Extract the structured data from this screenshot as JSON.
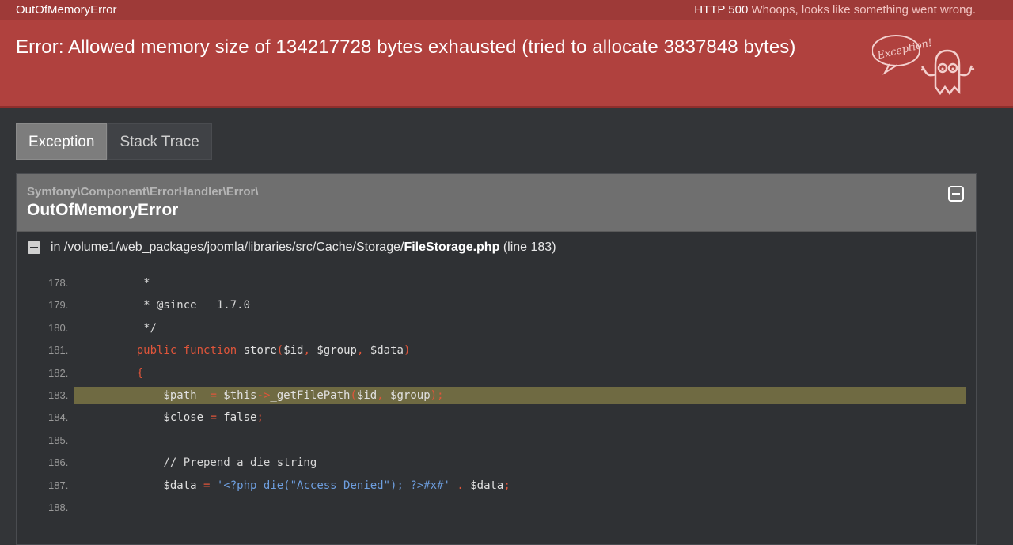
{
  "topbar": {
    "exception_name": "OutOfMemoryError",
    "status_code": "HTTP 500",
    "status_message": "Whoops, looks like something went wrong."
  },
  "error": {
    "message": "Error: Allowed memory size of 134217728 bytes exhausted (tried to allocate 3837848 bytes)"
  },
  "mascot": {
    "bubble_text": "Exception!"
  },
  "tabs": [
    {
      "label": "Exception",
      "active": true
    },
    {
      "label": "Stack Trace",
      "active": false
    }
  ],
  "exception": {
    "namespace": "Symfony\\Component\\ErrorHandler\\Error\\",
    "class_name": "OutOfMemoryError",
    "file_prefix": "in /volume1/web_packages/joomla/libraries/src/Cache/Storage/",
    "file_name": "FileStorage.php",
    "line_info": "(line 183)"
  },
  "code": {
    "highlight_line": "183.",
    "lines": [
      {
        "num": "178.",
        "text": "     *"
      },
      {
        "num": "179.",
        "text": "     * @since   1.7.0"
      },
      {
        "num": "180.",
        "text": "     */"
      },
      {
        "num": "181.",
        "text": "    public function store($id, $group, $data)"
      },
      {
        "num": "182.",
        "text": "    {"
      },
      {
        "num": "183.",
        "text": "        $path  = $this->_getFilePath($id, $group);"
      },
      {
        "num": "184.",
        "text": "        $close = false;"
      },
      {
        "num": "185.",
        "text": ""
      },
      {
        "num": "186.",
        "text": "        // Prepend a die string"
      },
      {
        "num": "187.",
        "text": "        $data = '<?php die(\"Access Denied\"); ?>#x#' . $data;"
      },
      {
        "num": "188.",
        "text": ""
      }
    ]
  }
}
